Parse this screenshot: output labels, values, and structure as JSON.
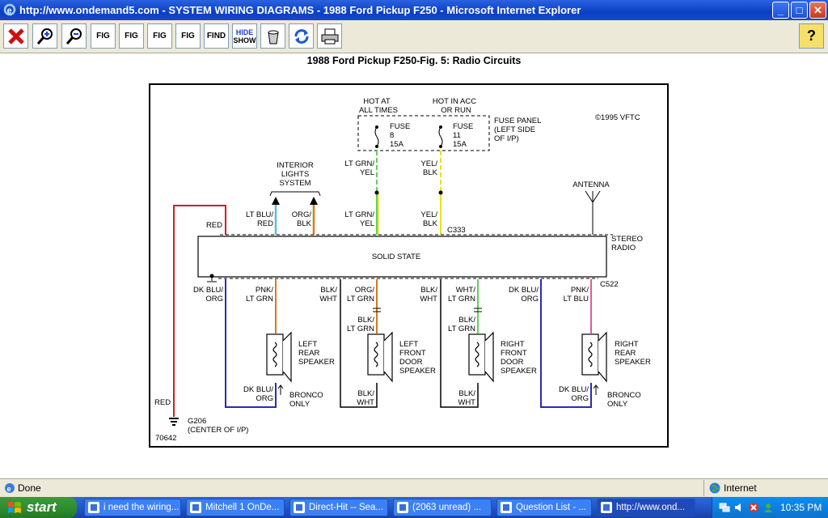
{
  "window": {
    "title": "http://www.ondemand5.com - SYSTEM WIRING DIAGRAMS - 1988 Ford Pickup F250 - Microsoft Internet Explorer",
    "minimize": "_",
    "maximize": "□",
    "close": "✕"
  },
  "toolbar": {
    "find_label": "FIND",
    "hide_label": "HIDE",
    "show_label": "SHOW",
    "fig_label": "FIG",
    "help_label": "?"
  },
  "diagram": {
    "title": "1988 Ford Pickup F250-Fig. 5: Radio Circuits",
    "copyright": "©1995 VFTC",
    "hot_at_1": "HOT AT",
    "hot_at_2": "ALL TIMES",
    "hot_acc_1": "HOT IN ACC",
    "hot_acc_2": "OR RUN",
    "fuse8_1": "FUSE",
    "fuse8_2": "8",
    "fuse8_3": "15A",
    "fuse11_1": "FUSE",
    "fuse11_2": "11",
    "fuse11_3": "15A",
    "fuse_panel_1": "FUSE PANEL",
    "fuse_panel_2": "(LEFT SIDE",
    "fuse_panel_3": "OF I/P)",
    "ltgrn_yel_top_1": "LT GRN/",
    "ltgrn_yel_top_2": "YEL",
    "yel_blk_top_1": "YEL/",
    "yel_blk_top_2": "BLK",
    "interior_1": "INTERIOR",
    "interior_2": "LIGHTS",
    "interior_3": "SYSTEM",
    "antenna": "ANTENNA",
    "red_top": "RED",
    "ltblu_red_1": "LT BLU/",
    "ltblu_red_2": "RED",
    "org_blk_1": "ORG/",
    "org_blk_2": "BLK",
    "ltgrn_yel_1": "LT GRN/",
    "ltgrn_yel_2": "YEL",
    "yel_blk_1": "YEL/",
    "yel_blk_2": "BLK",
    "c333": "C333",
    "stereo_1": "STEREO",
    "stereo_2": "RADIO",
    "solid_state": "SOLID STATE",
    "c522": "C522",
    "dkblu_org_left_1": "DK BLU/",
    "dkblu_org_left_2": "ORG",
    "pnk_ltgrn_1": "PNK/",
    "pnk_ltgrn_2": "LT GRN",
    "blk_wht_a_1": "BLK/",
    "blk_wht_a_2": "WHT",
    "org_ltgrn_1": "ORG/",
    "org_ltgrn_2": "LT GRN",
    "blk_wht_b_1": "BLK/",
    "blk_wht_b_2": "WHT",
    "wht_ltgrn_1": "WHT/",
    "wht_ltgrn_2": "LT GRN",
    "dkblu_org_mid_1": "DK BLU/",
    "dkblu_org_mid_2": "ORG",
    "pnk_ltblu_1": "PNK/",
    "pnk_ltblu_2": "LT BLU",
    "blk_ltgrn_a_1": "BLK/",
    "blk_ltgrn_a_2": "LT GRN",
    "blk_ltgrn_b_1": "BLK/",
    "blk_ltgrn_b_2": "LT GRN",
    "lrs_1": "LEFT",
    "lrs_2": "REAR",
    "lrs_3": "SPEAKER",
    "lfd_1": "LEFT",
    "lfd_2": "FRONT",
    "lfd_3": "DOOR",
    "lfd_4": "SPEAKER",
    "rfd_1": "RIGHT",
    "rfd_2": "FRONT",
    "rfd_3": "DOOR",
    "rfd_4": "SPEAKER",
    "rrs_1": "RIGHT",
    "rrs_2": "REAR",
    "rrs_3": "SPEAKER",
    "dkblu_org_b1_1": "DK BLU/",
    "dkblu_org_b1_2": "ORG",
    "bronco_a_1": "BRONCO",
    "bronco_a_2": "ONLY",
    "blk_wht_c_1": "BLK/",
    "blk_wht_c_2": "WHT",
    "blk_wht_d_1": "BLK/",
    "blk_wht_d_2": "WHT",
    "dkblu_org_b2_1": "DK BLU/",
    "dkblu_org_b2_2": "ORG",
    "bronco_b_1": "BRONCO",
    "bronco_b_2": "ONLY",
    "red_bottom": "RED",
    "g206_1": "G206",
    "g206_2": "(CENTER OF I/P)",
    "figure_number": "70642"
  },
  "status": {
    "text": "Done",
    "zone": "Internet"
  },
  "taskbar": {
    "start_label": "start",
    "tasks": [
      "i need the wiring...",
      "Mitchell 1 OnDe...",
      "Direct-Hit -- Sea...",
      "(2063 unread) ...",
      "Question List - ...",
      "http://www.ond..."
    ],
    "clock": "10:35 PM"
  },
  "colors": {
    "red": "#cc2020",
    "lt_blu": "#5bbfd6",
    "orange": "#d77a1c",
    "lt_grn": "#5fd05f",
    "yellow": "#e8e020",
    "dk_blu": "#2a2ab8",
    "pink": "#e05a9a",
    "black": "#000000"
  }
}
